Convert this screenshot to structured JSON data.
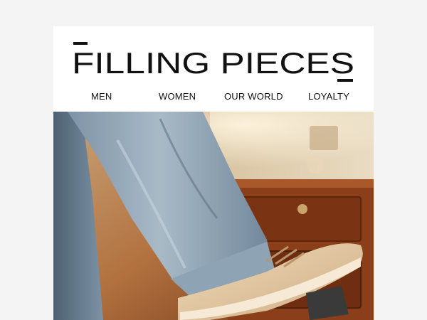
{
  "brand": {
    "logo_text": "FILLING PIECES",
    "colors": {
      "background": "#f4f4f4",
      "card": "#ffffff",
      "text": "#111111"
    }
  },
  "nav": {
    "items": [
      {
        "label": "MEN"
      },
      {
        "label": "WOMEN"
      },
      {
        "label": "OUR WORLD"
      },
      {
        "label": "LOYALTY"
      }
    ]
  },
  "hero": {
    "image": "denim-jeans-cream-sneaker-photo"
  }
}
